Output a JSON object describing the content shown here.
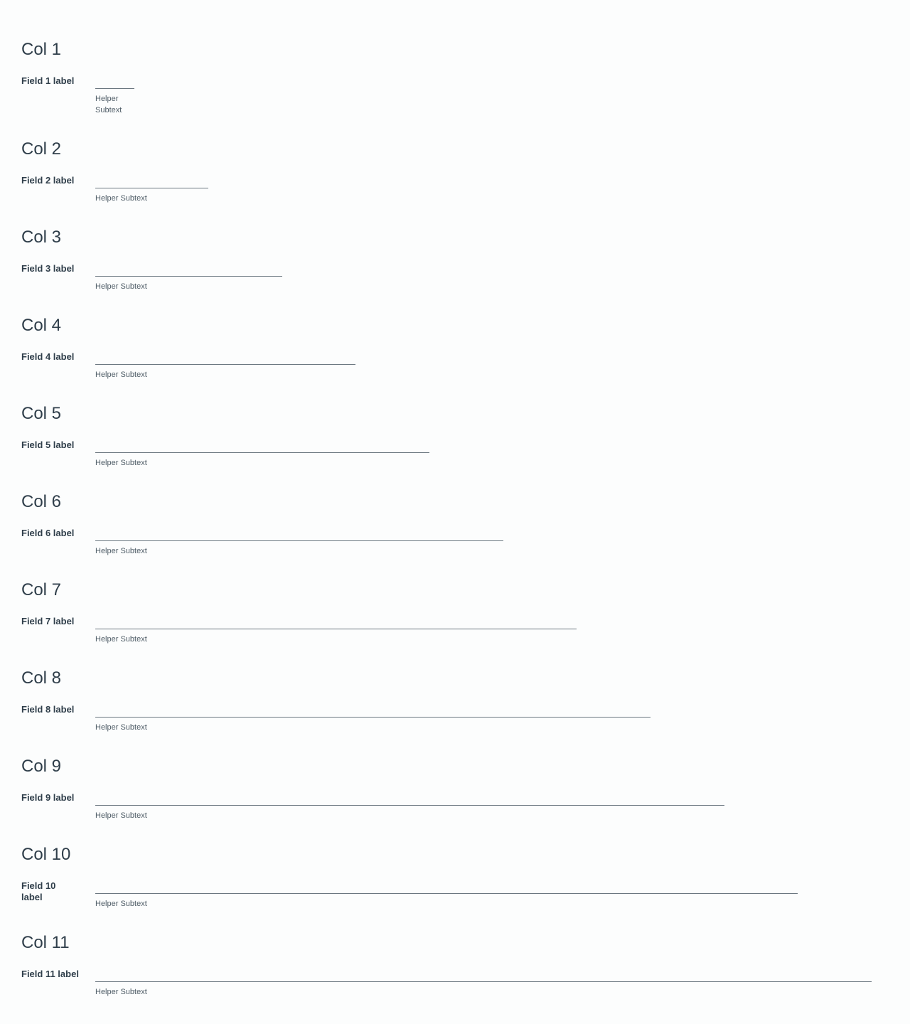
{
  "sections": [
    {
      "heading": "Col 1",
      "label": "Field 1 label",
      "helper": "Helper Subtext",
      "value": "",
      "placeholder": ""
    },
    {
      "heading": "Col 2",
      "label": "Field 2 label",
      "helper": "Helper Subtext",
      "value": "",
      "placeholder": ""
    },
    {
      "heading": "Col 3",
      "label": "Field 3 label",
      "helper": "Helper Subtext",
      "value": "",
      "placeholder": ""
    },
    {
      "heading": "Col 4",
      "label": "Field 4 label",
      "helper": "Helper Subtext",
      "value": "",
      "placeholder": ""
    },
    {
      "heading": "Col 5",
      "label": "Field 5 label",
      "helper": "Helper Subtext",
      "value": "",
      "placeholder": ""
    },
    {
      "heading": "Col 6",
      "label": "Field 6 label",
      "helper": "Helper Subtext",
      "value": "",
      "placeholder": ""
    },
    {
      "heading": "Col 7",
      "label": "Field 7 label",
      "helper": "Helper Subtext",
      "value": "",
      "placeholder": ""
    },
    {
      "heading": "Col 8",
      "label": "Field 8 label",
      "helper": "Helper Subtext",
      "value": "",
      "placeholder": ""
    },
    {
      "heading": "Col 9",
      "label": "Field 9 label",
      "helper": "Helper Subtext",
      "value": "",
      "placeholder": ""
    },
    {
      "heading": "Col 10",
      "label": "Field 10 label",
      "helper": "Helper Subtext",
      "value": "",
      "placeholder": ""
    },
    {
      "heading": "Col 11",
      "label": "Field 11 label",
      "helper": "Helper Subtext",
      "value": "",
      "placeholder": ""
    }
  ],
  "colors": {
    "text": "#2f3e4a",
    "helper": "#4f5d67",
    "input_border": "#6b7780",
    "background": "#fcfdfd"
  }
}
